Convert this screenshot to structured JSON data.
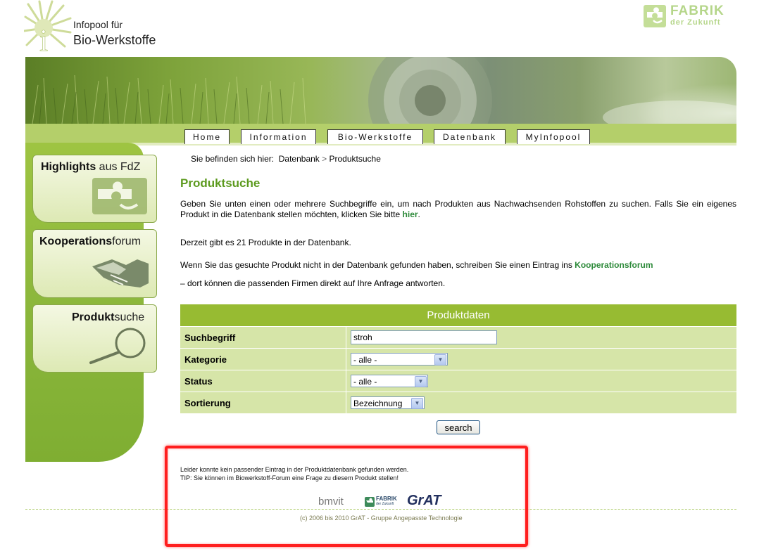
{
  "site": {
    "logo_line1": "Infopool für",
    "logo_line2": "Bio-Werkstoffe",
    "partner_name": "FABRIK",
    "partner_sub": "der Zukunft"
  },
  "nav": {
    "items": [
      "Home",
      "Information",
      "Bio-Werkstoffe",
      "Datenbank",
      "MyInfopool"
    ]
  },
  "sidebar": {
    "items": [
      {
        "bold": "Highlights",
        "rest": " aus FdZ",
        "icon": "puzzle-logo-icon"
      },
      {
        "bold": "Kooperations",
        "rest": "forum",
        "icon": "handshake-icon"
      },
      {
        "bold": "Produkt",
        "rest": "suche",
        "icon": "magnifier-icon"
      }
    ]
  },
  "breadcrumb": {
    "prefix": "Sie befinden sich hier:",
    "level1": "Datenbank",
    "separator": ">",
    "current": "Produktsuche"
  },
  "page": {
    "title": "Produktsuche",
    "intro": "Geben Sie unten einen oder mehrere Suchbegriffe ein, um nach Produkten aus Nachwachsenden Rohstoffen zu suchen. Falls Sie ein eigenes Produkt in die Datenbank stellen möchten, klicken Sie bitte",
    "intro_link": "hier",
    "intro_end": ".",
    "count_text": "Derzeit gibt es 21 Produkte in der Datenbank.",
    "forum_text": "Wenn Sie das gesuchte Produkt nicht in der Datenbank gefunden haben, schreiben Sie einen Eintrag ins",
    "forum_link": "Kooperationsforum",
    "forum_text2": "– dort können die passenden Firmen direkt auf Ihre Anfrage antworten."
  },
  "form": {
    "header": "Produktdaten",
    "search_label": "Suchbegriff",
    "search_value": "stroh",
    "category_label": "Kategorie",
    "category_value": "- alle -",
    "status_label": "Status",
    "status_value": "- alle -",
    "sort_label": "Sortierung",
    "sort_value": "Bezeichnung",
    "submit_label": "search"
  },
  "result": {
    "line1": "Leider konnte kein passender Eintrag in der Produktdatenbank gefunden werden.",
    "line2": "TIP: Sie können im Biowerkstoff-Forum eine Frage zu diesem Produkt stellen!"
  },
  "footer": {
    "logo_bmvit": "bmvit",
    "logo_fdz_name": "FABRIK",
    "logo_fdz_sub": "der Zukunft",
    "logo_grat": "GrAT",
    "copyright": "(c) 2006 bis 2010 GrAT - Gruppe Angepasste Technologie"
  },
  "colors": {
    "brand_green": "#97bb32",
    "title_green": "#5c9a1e",
    "link_green": "#2d8a3a",
    "highlight_red": "#ff1e1e"
  }
}
